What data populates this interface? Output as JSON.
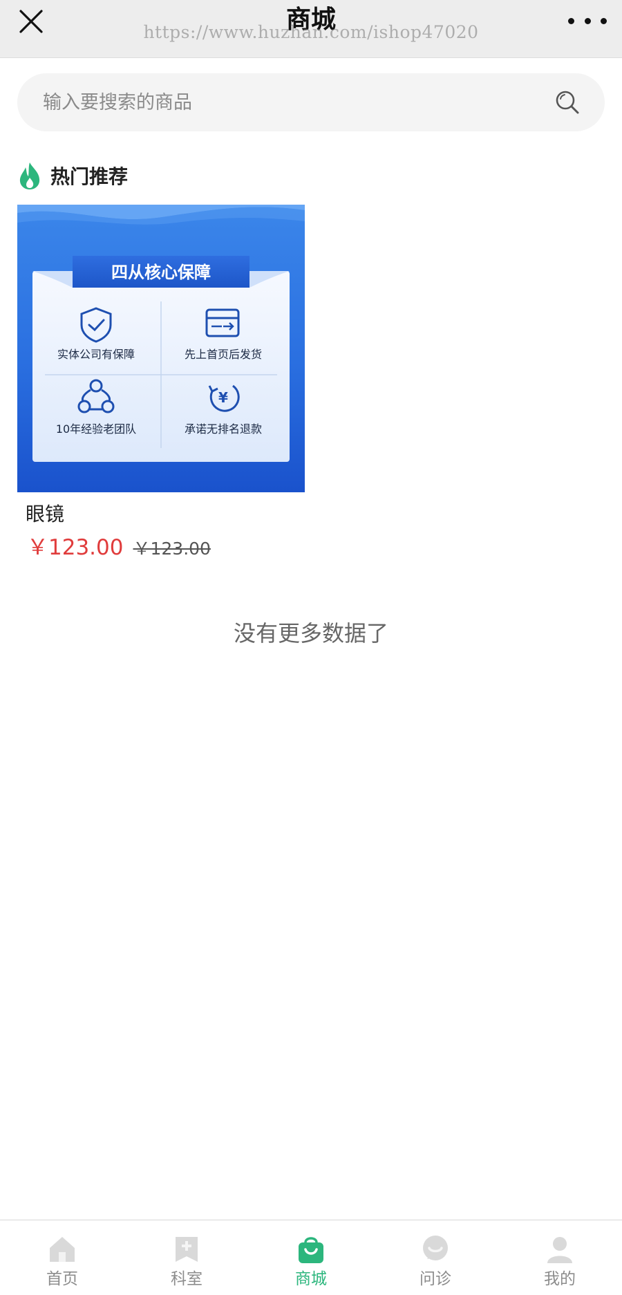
{
  "navbar": {
    "title": "商城",
    "watermark": "https://www.huzhan.com/ishop47020"
  },
  "search": {
    "placeholder": "输入要搜索的商品"
  },
  "section": {
    "title": "热门推荐"
  },
  "product": {
    "banner": {
      "heading": "四从核心保障",
      "features": [
        {
          "icon": "shield-check-icon",
          "label": "实体公司有保障"
        },
        {
          "icon": "delivery-box-icon",
          "label": "先上首页后发货"
        },
        {
          "icon": "team-icon",
          "label": "10年经验老团队"
        },
        {
          "icon": "refund-yen-icon",
          "label": "承诺无排名退款"
        }
      ]
    },
    "name": "眼镜",
    "price": "￥123.00",
    "original_price": "￥123.00"
  },
  "no_more_text": "没有更多数据了",
  "tabbar": {
    "active": "商城",
    "tabs": [
      {
        "icon": "home-icon",
        "label": "首页"
      },
      {
        "icon": "department-icon",
        "label": "科室"
      },
      {
        "icon": "shop-bag-icon",
        "label": "商城"
      },
      {
        "icon": "consult-icon",
        "label": "问诊"
      },
      {
        "icon": "user-icon",
        "label": "我的"
      }
    ]
  },
  "colors": {
    "accent": "#2cb67d",
    "price": "#e03c3c",
    "banner_blue": "#1f5fd8",
    "navbar_bg": "#ededed"
  }
}
